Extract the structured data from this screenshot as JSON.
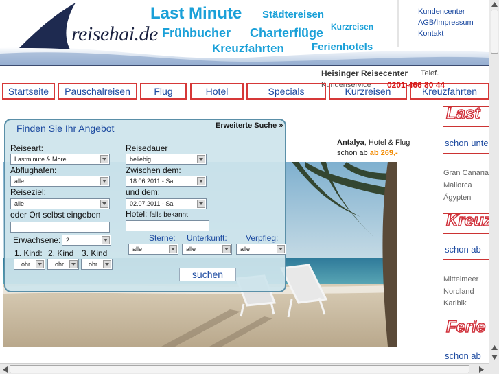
{
  "header": {
    "logo_text": "reisehai.de",
    "links": {
      "last_minute": "Last Minute",
      "staedtereisen": "Städtereisen",
      "fruehbucher": "Frühbucher",
      "charterfluege": "Charterflüge",
      "kurzreisen": "Kurzreisen",
      "kreuzfahrten": "Kreuzfahrten",
      "ferienhotels": "Ferienhotels"
    },
    "top_links": {
      "kundencenter": "Kundencenter",
      "agb": "AGB/Impressum",
      "kontakt": "Kontakt"
    }
  },
  "info": {
    "center_name": "Heisinger Reisecenter",
    "telef": "Telef.",
    "kundenservice": "Kundenservice",
    "phone": "0201-466 80 44"
  },
  "nav": [
    "Startseite",
    "Pauschalreisen",
    "Flug",
    "Hotel",
    "Specials",
    "Kurzreisen",
    "Kreuzfahrten"
  ],
  "search": {
    "title": "Finden Sie Ihr Angebot",
    "advanced": "Erweiterte Suche »",
    "reiseart_label": "Reiseart:",
    "reiseart_value": "Lastminute & More",
    "abflughafen_label": "Abflughafen:",
    "abflughafen_value": "alle",
    "reiseziel_label": "Reiseziel:",
    "reiseziel_value": "alle",
    "ort_label": "oder Ort selbst eingeben",
    "erwachsene_label": "Erwachsene:",
    "erwachsene_value": "2",
    "kind1_label": "1. Kind:",
    "kind2_label": "2. Kind",
    "kind3_label": "3. Kind",
    "kind_value": "ohr",
    "reisedauer_label": "Reisedauer",
    "reisedauer_value": "beliebig",
    "zwischen_label": "Zwischen dem:",
    "zwischen_value": "18.06.2011 - Sa",
    "und_label": "und dem:",
    "und_value": "02.07.2011 - Sa",
    "hotel_label": "Hotel:",
    "hotel_hint": "falls bekannt",
    "sterne_label": "Sterne:",
    "sterne_value": "alle",
    "unterkunft_label": "Unterkunft:",
    "unterkunft_value": "alle",
    "verpfleg_label": "Verpfleg:",
    "verpfleg_value": "alle",
    "submit": "suchen"
  },
  "promo": {
    "destination": "Antalya",
    "type": ", Hotel & Flug",
    "prefix": "schon ab",
    "price": "ab 269,-"
  },
  "side": {
    "lastminute_banner": "Last",
    "lastminute_sub": "schon unte",
    "destinations1": [
      "Gran Canaria",
      "Mallorca",
      "Ägypten"
    ],
    "kreuz_banner": "Kreuz",
    "kreuz_sub": "schon ab",
    "destinations2": [
      "Mittelmeer",
      "Nordland",
      "Karibik"
    ],
    "ferien_banner": "Ferie",
    "ferien_sub": "schon ab"
  },
  "colors": {
    "accent_blue": "#1aa0d8",
    "nav_border": "#d63838",
    "link_blue": "#1c4aa0",
    "phone_red": "#d81818",
    "price_orange": "#f28a00"
  }
}
